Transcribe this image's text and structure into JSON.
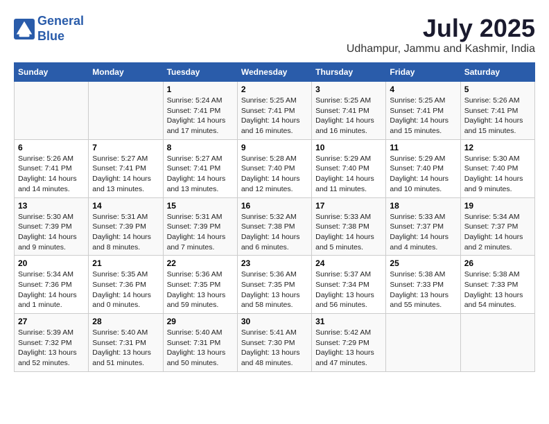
{
  "header": {
    "logo_line1": "General",
    "logo_line2": "Blue",
    "month": "July 2025",
    "location": "Udhampur, Jammu and Kashmir, India"
  },
  "columns": [
    "Sunday",
    "Monday",
    "Tuesday",
    "Wednesday",
    "Thursday",
    "Friday",
    "Saturday"
  ],
  "weeks": [
    [
      {
        "day": "",
        "content": ""
      },
      {
        "day": "",
        "content": ""
      },
      {
        "day": "1",
        "content": "Sunrise: 5:24 AM\nSunset: 7:41 PM\nDaylight: 14 hours and 17 minutes."
      },
      {
        "day": "2",
        "content": "Sunrise: 5:25 AM\nSunset: 7:41 PM\nDaylight: 14 hours and 16 minutes."
      },
      {
        "day": "3",
        "content": "Sunrise: 5:25 AM\nSunset: 7:41 PM\nDaylight: 14 hours and 16 minutes."
      },
      {
        "day": "4",
        "content": "Sunrise: 5:25 AM\nSunset: 7:41 PM\nDaylight: 14 hours and 15 minutes."
      },
      {
        "day": "5",
        "content": "Sunrise: 5:26 AM\nSunset: 7:41 PM\nDaylight: 14 hours and 15 minutes."
      }
    ],
    [
      {
        "day": "6",
        "content": "Sunrise: 5:26 AM\nSunset: 7:41 PM\nDaylight: 14 hours and 14 minutes."
      },
      {
        "day": "7",
        "content": "Sunrise: 5:27 AM\nSunset: 7:41 PM\nDaylight: 14 hours and 13 minutes."
      },
      {
        "day": "8",
        "content": "Sunrise: 5:27 AM\nSunset: 7:41 PM\nDaylight: 14 hours and 13 minutes."
      },
      {
        "day": "9",
        "content": "Sunrise: 5:28 AM\nSunset: 7:40 PM\nDaylight: 14 hours and 12 minutes."
      },
      {
        "day": "10",
        "content": "Sunrise: 5:29 AM\nSunset: 7:40 PM\nDaylight: 14 hours and 11 minutes."
      },
      {
        "day": "11",
        "content": "Sunrise: 5:29 AM\nSunset: 7:40 PM\nDaylight: 14 hours and 10 minutes."
      },
      {
        "day": "12",
        "content": "Sunrise: 5:30 AM\nSunset: 7:40 PM\nDaylight: 14 hours and 9 minutes."
      }
    ],
    [
      {
        "day": "13",
        "content": "Sunrise: 5:30 AM\nSunset: 7:39 PM\nDaylight: 14 hours and 9 minutes."
      },
      {
        "day": "14",
        "content": "Sunrise: 5:31 AM\nSunset: 7:39 PM\nDaylight: 14 hours and 8 minutes."
      },
      {
        "day": "15",
        "content": "Sunrise: 5:31 AM\nSunset: 7:39 PM\nDaylight: 14 hours and 7 minutes."
      },
      {
        "day": "16",
        "content": "Sunrise: 5:32 AM\nSunset: 7:38 PM\nDaylight: 14 hours and 6 minutes."
      },
      {
        "day": "17",
        "content": "Sunrise: 5:33 AM\nSunset: 7:38 PM\nDaylight: 14 hours and 5 minutes."
      },
      {
        "day": "18",
        "content": "Sunrise: 5:33 AM\nSunset: 7:37 PM\nDaylight: 14 hours and 4 minutes."
      },
      {
        "day": "19",
        "content": "Sunrise: 5:34 AM\nSunset: 7:37 PM\nDaylight: 14 hours and 2 minutes."
      }
    ],
    [
      {
        "day": "20",
        "content": "Sunrise: 5:34 AM\nSunset: 7:36 PM\nDaylight: 14 hours and 1 minute."
      },
      {
        "day": "21",
        "content": "Sunrise: 5:35 AM\nSunset: 7:36 PM\nDaylight: 14 hours and 0 minutes."
      },
      {
        "day": "22",
        "content": "Sunrise: 5:36 AM\nSunset: 7:35 PM\nDaylight: 13 hours and 59 minutes."
      },
      {
        "day": "23",
        "content": "Sunrise: 5:36 AM\nSunset: 7:35 PM\nDaylight: 13 hours and 58 minutes."
      },
      {
        "day": "24",
        "content": "Sunrise: 5:37 AM\nSunset: 7:34 PM\nDaylight: 13 hours and 56 minutes."
      },
      {
        "day": "25",
        "content": "Sunrise: 5:38 AM\nSunset: 7:33 PM\nDaylight: 13 hours and 55 minutes."
      },
      {
        "day": "26",
        "content": "Sunrise: 5:38 AM\nSunset: 7:33 PM\nDaylight: 13 hours and 54 minutes."
      }
    ],
    [
      {
        "day": "27",
        "content": "Sunrise: 5:39 AM\nSunset: 7:32 PM\nDaylight: 13 hours and 52 minutes."
      },
      {
        "day": "28",
        "content": "Sunrise: 5:40 AM\nSunset: 7:31 PM\nDaylight: 13 hours and 51 minutes."
      },
      {
        "day": "29",
        "content": "Sunrise: 5:40 AM\nSunset: 7:31 PM\nDaylight: 13 hours and 50 minutes."
      },
      {
        "day": "30",
        "content": "Sunrise: 5:41 AM\nSunset: 7:30 PM\nDaylight: 13 hours and 48 minutes."
      },
      {
        "day": "31",
        "content": "Sunrise: 5:42 AM\nSunset: 7:29 PM\nDaylight: 13 hours and 47 minutes."
      },
      {
        "day": "",
        "content": ""
      },
      {
        "day": "",
        "content": ""
      }
    ]
  ]
}
